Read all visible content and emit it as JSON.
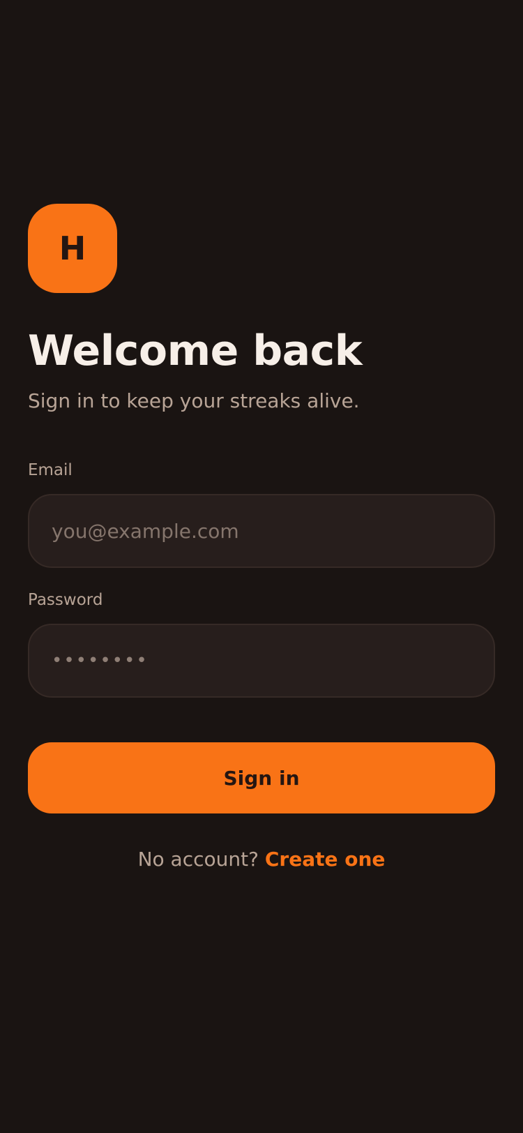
{
  "brand": {
    "logo_letter": "H",
    "accent_color": "#f97316",
    "background_color": "#1a1412"
  },
  "header": {
    "title": "Welcome back",
    "subtitle": "Sign in to keep your streaks alive."
  },
  "form": {
    "email": {
      "label": "Email",
      "placeholder": "you@example.com",
      "value": ""
    },
    "password": {
      "label": "Password",
      "value": "••••••••"
    },
    "submit_label": "Sign in"
  },
  "footer": {
    "prompt": "No account?",
    "link_label": "Create one"
  }
}
